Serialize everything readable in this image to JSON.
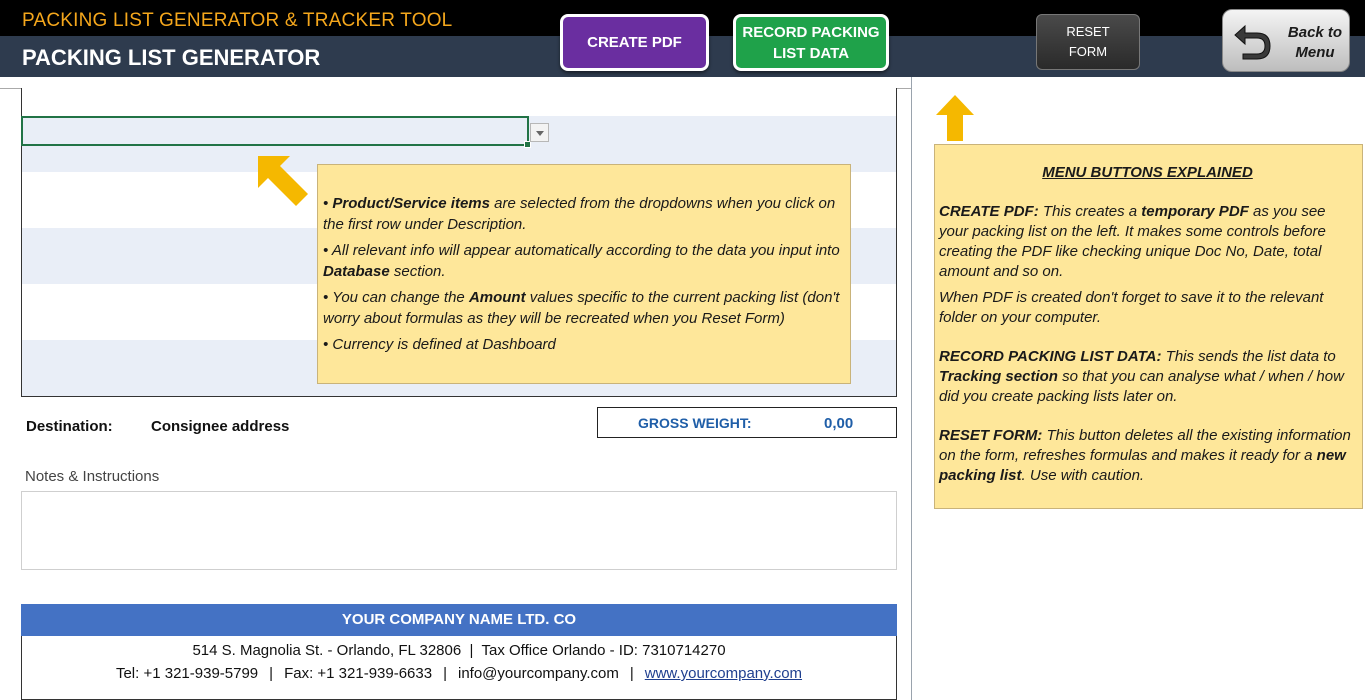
{
  "header": {
    "app_title": "PACKING LIST GENERATOR & TRACKER TOOL",
    "page_title": "PACKING LIST GENERATOR",
    "buttons": {
      "create_pdf": "CREATE PDF",
      "record_line1": "RECORD PACKING",
      "record_line2": "LIST DATA",
      "reset_line1": "RESET",
      "reset_line2": "FORM",
      "back_line1": "Back to",
      "back_line2": "Menu"
    }
  },
  "left_note": {
    "b1_bold": "Product/Service items",
    "b1_rest": " are selected from the dropdowns when you click on the first row under Description.",
    "b2_pre": "All relevant info will appear automatically according to the data you input into ",
    "b2_bold": "Database",
    "b2_post": " section.",
    "b3_pre": "You can change the ",
    "b3_bold": "Amount",
    "b3_post": " values specific to the current packing list (don't worry about formulas as they will be recreated when you Reset Form)",
    "b4": "Currency is defined at Dashboard"
  },
  "form": {
    "destination_label": "Destination:",
    "destination_value": "Consignee address",
    "gross_weight_label": "GROSS WEIGHT:",
    "gross_weight_value": "0,00",
    "notes_label": "Notes & Instructions"
  },
  "company": {
    "name": "YOUR COMPANY NAME LTD. CO",
    "address_line": "514 S. Magnolia St. - Orlando, FL 32806  |  Tax Office Orlando - ID: 7310714270",
    "tel": "Tel: +1 321-939-5799",
    "fax": "Fax: +1 321-939-6633",
    "email": "info@yourcompany.com",
    "website": "www.yourcompany.com",
    "separator": "|"
  },
  "right_note": {
    "title": "MENU BUTTONS EXPLAINED",
    "pdf_label": "CREATE PDF:",
    "pdf_pre": " This creates a ",
    "pdf_bold": "temporary PDF",
    "pdf_post": " as you see your packing list on the left. It makes some controls before creating the PDF like checking unique Doc No, Date, total amount and so on.",
    "pdf_save": "When PDF is created don't forget to save it to the relevant folder on your computer.",
    "record_label": "RECORD PACKING LIST DATA:",
    "record_pre": " This sends the list data to ",
    "record_bold": "Tracking section",
    "record_post": " so that you can analyse what / when / how did you create packing lists later on.",
    "reset_label": "RESET FORM:",
    "reset_pre": " This button deletes all the existing information on the form, refreshes formulas and makes it ready for a ",
    "reset_bold": "new packing list",
    "reset_post": ". Use with caution."
  },
  "colors": {
    "header_bg_top": "#000000",
    "header_bg_bottom": "#2e3b4e",
    "app_title": "#f5a71c",
    "create_pdf_btn": "#6a2ea0",
    "record_btn": "#1fa24a",
    "note_bg": "#fee79a",
    "company_bar": "#4472c4",
    "gross_weight_text": "#1f5ea8",
    "arrow": "#f5b800"
  },
  "icons": {
    "back": "u-turn-arrow-icon",
    "dropdown": "chevron-down-icon",
    "pointer_diagonal": "arrow-up-left-icon",
    "pointer_up": "arrow-up-icon"
  }
}
